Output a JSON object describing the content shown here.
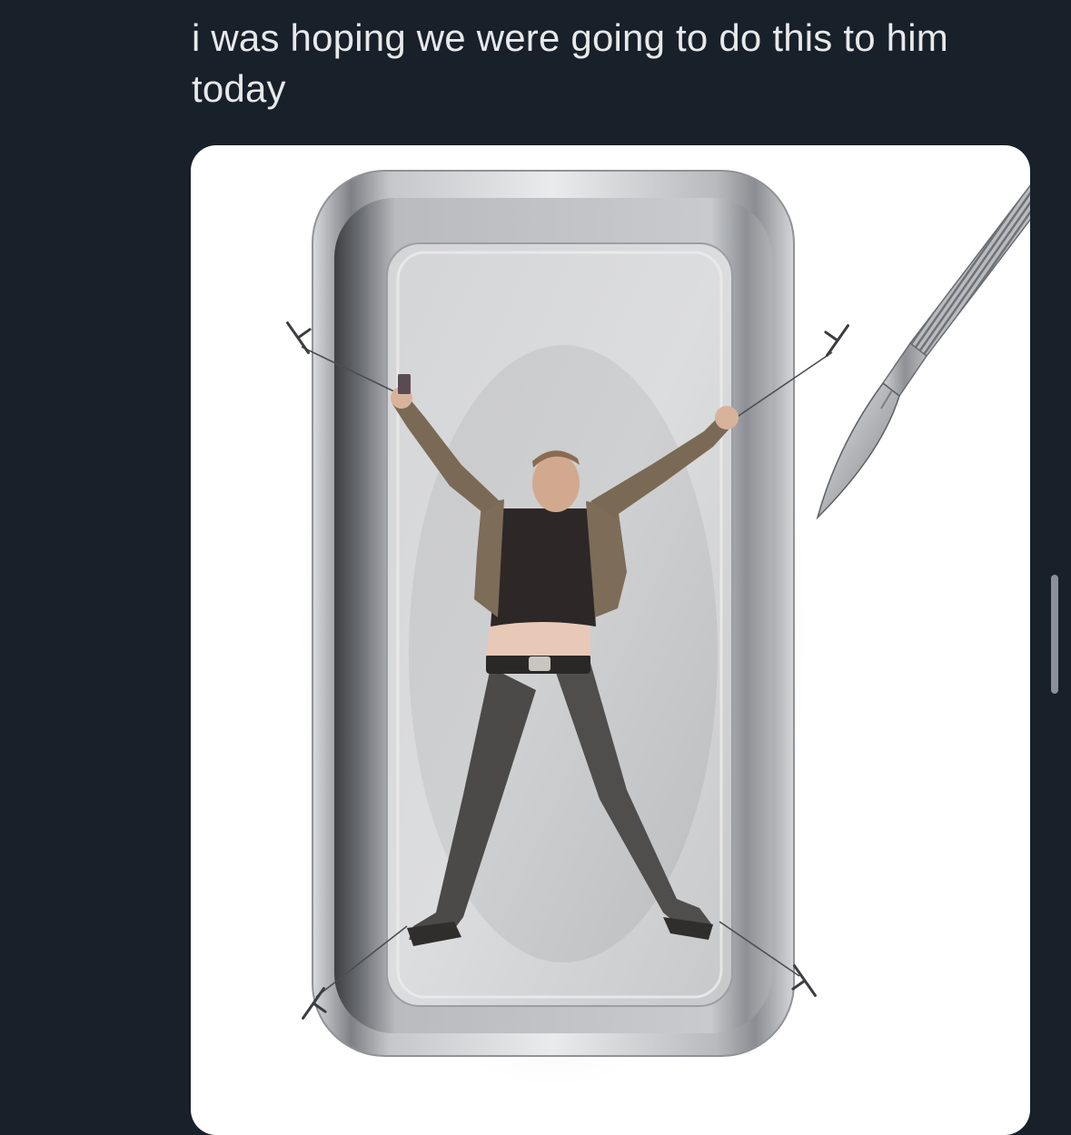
{
  "tweet": {
    "text": "i was hoping we were going to do this to him today"
  },
  "media": {
    "alt": "Photo of a man pinned spread-eagle in a stainless steel tray like a dissection specimen, with a scalpel beside the tray"
  },
  "colors": {
    "background": "#18202a",
    "text": "#e7e9ea",
    "card": "#ffffff",
    "scrollbar": "#8b9096"
  }
}
